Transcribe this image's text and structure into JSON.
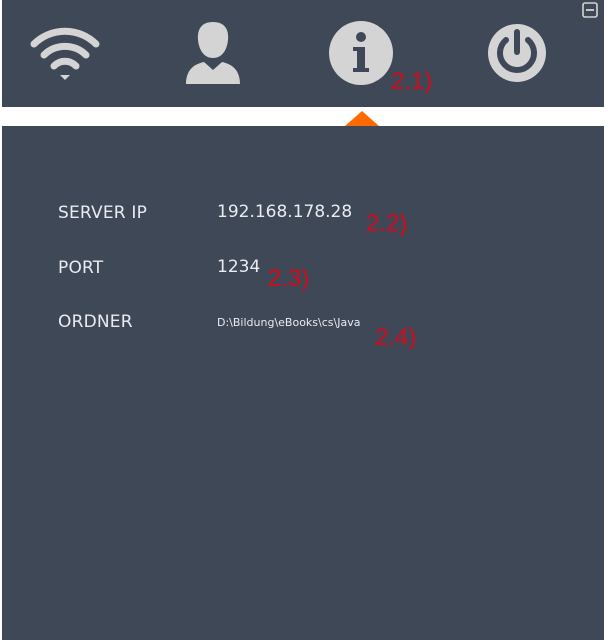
{
  "tabs": [
    {
      "icon": "wifi-icon"
    },
    {
      "icon": "user-icon"
    },
    {
      "icon": "info-icon",
      "active": true
    },
    {
      "icon": "power-icon"
    }
  ],
  "window": {
    "minimize_icon": "minimize-icon"
  },
  "colors": {
    "background": "#3f4857",
    "icon": "#d4d4d4",
    "accent": "#ff6a00",
    "annotation": "#d8091a",
    "text": "#e9ecf1"
  },
  "info": {
    "server_ip_label": "SERVER IP",
    "server_ip_value": "192.168.178.28",
    "port_label": "PORT",
    "port_value": "1234",
    "folder_label": "ORDNER",
    "folder_value": "D:\\Bildung\\eBooks\\cs\\Java"
  },
  "annotations": {
    "a1": "2.1)",
    "a2": "2.2)",
    "a3": "2.3)",
    "a4": "2.4)"
  }
}
